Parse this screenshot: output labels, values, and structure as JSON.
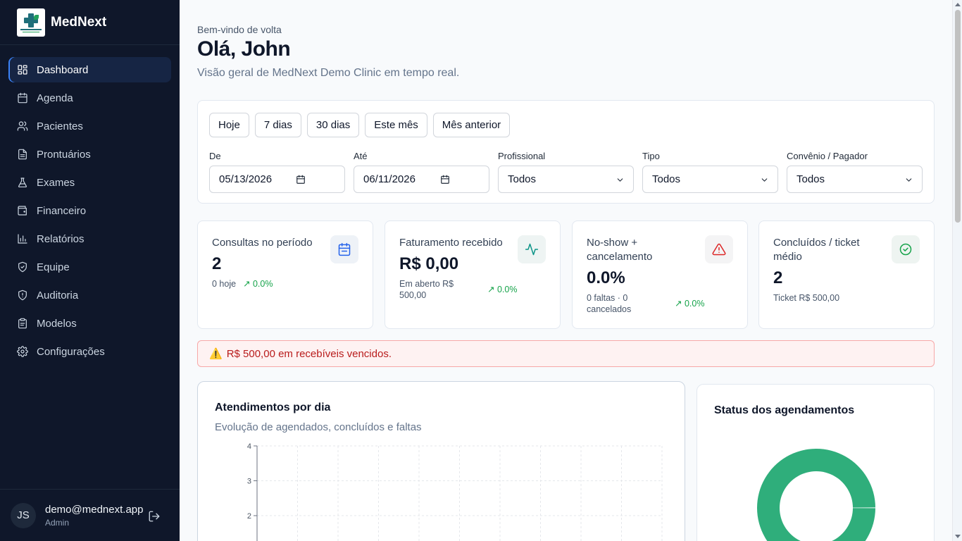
{
  "app": {
    "name": "MedNext"
  },
  "sidebar": {
    "items": [
      {
        "label": "Dashboard",
        "icon": "dashboard-grid-icon",
        "active": true
      },
      {
        "label": "Agenda",
        "icon": "calendar-icon"
      },
      {
        "label": "Pacientes",
        "icon": "users-icon"
      },
      {
        "label": "Prontuários",
        "icon": "file-text-icon"
      },
      {
        "label": "Exames",
        "icon": "flask-icon"
      },
      {
        "label": "Financeiro",
        "icon": "wallet-icon"
      },
      {
        "label": "Relatórios",
        "icon": "bar-chart-icon"
      },
      {
        "label": "Equipe",
        "icon": "shield-check-icon"
      },
      {
        "label": "Auditoria",
        "icon": "shield-alert-icon"
      },
      {
        "label": "Modelos",
        "icon": "clipboard-icon"
      },
      {
        "label": "Configurações",
        "icon": "gear-icon"
      }
    ],
    "user": {
      "initials": "JS",
      "email": "demo@mednext.app",
      "role": "Admin"
    }
  },
  "header": {
    "welcome": "Bem-vindo de volta",
    "greeting": "Olá, John",
    "subtitle": "Visão geral de MedNext Demo Clinic em tempo real."
  },
  "filters": {
    "presets": [
      "Hoje",
      "7 dias",
      "30 dias",
      "Este mês",
      "Mês anterior"
    ],
    "from": {
      "label": "De",
      "value": "05/13/2026"
    },
    "to": {
      "label": "Até",
      "value": "06/11/2026"
    },
    "professional": {
      "label": "Profissional",
      "value": "Todos"
    },
    "type": {
      "label": "Tipo",
      "value": "Todos"
    },
    "payer": {
      "label": "Convênio / Pagador",
      "value": "Todos"
    }
  },
  "kpis": [
    {
      "title": "Consultas no período",
      "value": "2",
      "sub": "0 hoje",
      "delta": "↗ 0.0%",
      "icon": "calendar-icon",
      "icon_color": "#2563eb",
      "icon_bg": "#eef2f7"
    },
    {
      "title": "Faturamento recebido",
      "value": "R$ 0,00",
      "sub": "Em aberto R$ 500,00",
      "delta": "↗ 0.0%",
      "icon": "activity-icon",
      "icon_color": "#0d9488",
      "icon_bg": "#eef4f3"
    },
    {
      "title": "No-show + cancelamento",
      "value": "0.0%",
      "sub": "0 faltas · 0 cancelados",
      "delta": "↗ 0.0%",
      "icon": "alert-triangle-icon",
      "icon_color": "#dc2626",
      "icon_bg": "#f4f4f5"
    },
    {
      "title": "Concluídos / ticket médio",
      "value": "2",
      "sub": "Ticket R$ 500,00",
      "delta": "",
      "icon": "check-circle-icon",
      "icon_color": "#16a34a",
      "icon_bg": "#eef4f1"
    }
  ],
  "alert": {
    "icon": "⚠️",
    "text": "R$ 500,00 em recebíveis vencidos."
  },
  "charts": {
    "daily": {
      "title": "Atendimentos por dia",
      "subtitle": "Evolução de agendados, concluídos e faltas"
    },
    "status": {
      "title": "Status dos agendamentos"
    }
  },
  "chart_data": [
    {
      "type": "line",
      "title": "Atendimentos por dia",
      "subtitle": "Evolução de agendados, concluídos e faltas",
      "y_ticks": [
        4,
        3,
        2
      ],
      "ylim": [
        0,
        4
      ],
      "grid": true
    },
    {
      "type": "pie",
      "title": "Status dos agendamentos",
      "values": [
        100
      ],
      "colors": [
        "#2fae7b"
      ]
    }
  ],
  "colors": {
    "sidebar_bg": "#0f172a",
    "accent": "#3b82f6",
    "danger": "#b91c1c",
    "success": "#16a34a",
    "donut": "#2fae7b"
  }
}
